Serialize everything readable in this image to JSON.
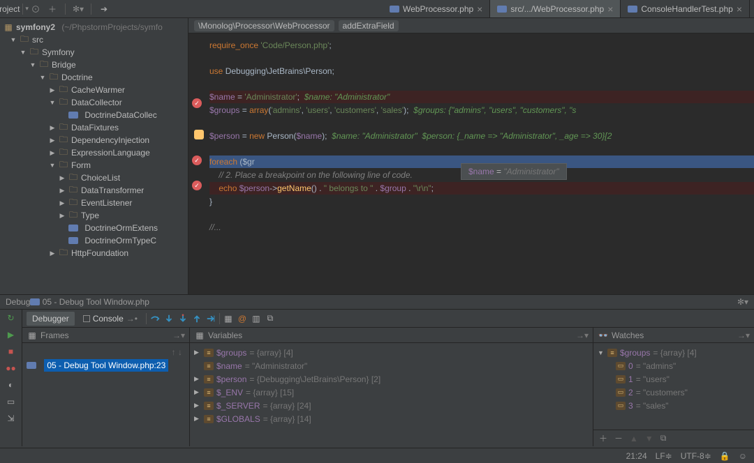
{
  "toolbar": {
    "project_label": "Project"
  },
  "tabs": [
    {
      "label": "WebProcessor.php",
      "active": false
    },
    {
      "label": "src/.../WebProcessor.php",
      "active": true
    },
    {
      "label": "ConsoleHandlerTest.php",
      "active": false
    }
  ],
  "breadcrumbs": {
    "a": "\\Monolog\\Processor\\WebProcessor",
    "b": "addExtraField"
  },
  "tree": {
    "root": "symfony2",
    "root_hint": "(~/PhpstormProjects/symfo",
    "src": "src",
    "symfony": "Symfony",
    "bridge": "Bridge",
    "doctrine": "Doctrine",
    "cachewarmer": "CacheWarmer",
    "datacollector": "DataCollector",
    "doctrinedatacoll": "DoctrineDataCollec",
    "datafixtures": "DataFixtures",
    "di": "DependencyInjection",
    "el": "ExpressionLanguage",
    "form": "Form",
    "choicelist": "ChoiceList",
    "datatransformer": "DataTransformer",
    "eventlistener": "EventListener",
    "type": "Type",
    "doctrineormext": "DoctrineOrmExtens",
    "doctrineormtypec": "DoctrineOrmTypeC",
    "httpfoundation": "HttpFoundation"
  },
  "code": {
    "l1a": "require_once ",
    "l1b": "'Code/Person.php'",
    "l1c": ";",
    "l2a": "use ",
    "l2b": "Debugging\\JetBrains\\Person;",
    "l3a": "$name",
    "l3b": " = ",
    "l3c": "'Administrator'",
    "l3d": ";  ",
    "l3e": "$name: \"Administrator\"",
    "l4a": "$groups",
    "l4b": " = ",
    "l4c": "array",
    "l4d": "(",
    "l4e": "'admins'",
    "l4f": ", ",
    "l4g": "'users'",
    "l4h": ", ",
    "l4i": "'customers'",
    "l4j": ", ",
    "l4k": "'sales'",
    "l4l": ");  ",
    "l4m": "$groups: {\"admins\", \"users\", \"customers\", \"s",
    "l5a": "$person",
    "l5b": " = ",
    "l5c": "new ",
    "l5d": "Person(",
    "l5e": "$name",
    "l5f": ");  ",
    "l5g": "$name: \"Administrator\"  $person: {_name => \"Administrator\", _age => 30}[2",
    "l6a": "foreach ",
    "l6b": "($gr",
    "l7a": "    // 2. Place a breakpoint on the following line of code.",
    "l8a": "    ",
    "l8b": "echo ",
    "l8c": "$person",
    "l8d": "->",
    "l8e": "getName",
    "l8f": "() . ",
    "l8g": "\" belongs to \"",
    "l8h": " . ",
    "l8i": "$group",
    "l8j": " . ",
    "l8k": "\"\\r\\n\"",
    "l8l": ";",
    "l9": "}",
    "l10a": "//..."
  },
  "tooltip": {
    "var": "$name",
    "eq": " = ",
    "val": "\"Administrator\""
  },
  "debug_status": {
    "prefix": "Debug ",
    "file": "05 - Debug Tool Window.php"
  },
  "debug_tabs": {
    "debugger": "Debugger",
    "console": "Console"
  },
  "frames": {
    "title": "Frames",
    "item": "05 - Debug Tool Window.php:23"
  },
  "variables": {
    "title": "Variables",
    "rows": [
      {
        "name": "$groups",
        "val": " = {array} [4]"
      },
      {
        "name": "$name",
        "val": " = \"Administrator\""
      },
      {
        "name": "$person",
        "val": " = {Debugging\\JetBrains\\Person} [2]"
      },
      {
        "name": "$_ENV",
        "val": " = {array} [15]"
      },
      {
        "name": "$_SERVER",
        "val": " = {array} [24]"
      },
      {
        "name": "$GLOBALS",
        "val": " = {array} [14]"
      }
    ]
  },
  "watches": {
    "title": "Watches",
    "root_name": "$groups",
    "root_val": " = {array} [4]",
    "items": [
      {
        "key": "0",
        "val": " = \"admins\""
      },
      {
        "key": "1",
        "val": " = \"users\""
      },
      {
        "key": "2",
        "val": " = \"customers\""
      },
      {
        "key": "3",
        "val": " = \"sales\""
      }
    ]
  },
  "status": {
    "pos": "21:24",
    "lf": "LF≑",
    "enc": "UTF-8≑",
    "lock": "🔒"
  }
}
